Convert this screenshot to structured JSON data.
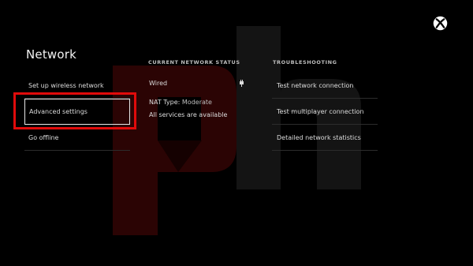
{
  "page": {
    "title": "Network"
  },
  "menu": {
    "items": [
      {
        "label": "Set up wireless network"
      },
      {
        "label": "Advanced settings"
      },
      {
        "label": "Go offline"
      }
    ]
  },
  "status": {
    "header": "CURRENT NETWORK STATUS",
    "connection": "Wired",
    "nat_label": "NAT Type:",
    "nat_value": "Moderate",
    "services": "All services are available"
  },
  "troubleshooting": {
    "header": "TROUBLESHOOTING",
    "items": [
      {
        "label": "Test network connection"
      },
      {
        "label": "Test multiplayer connection"
      },
      {
        "label": "Detailed network statistics"
      }
    ]
  },
  "icons": {
    "logo": "xbox-logo-icon",
    "connection": "ethernet-plug-icon"
  },
  "colors": {
    "background": "#000000",
    "highlight": "#e00b0b",
    "watermark_red": "#3a0505",
    "watermark_gray": "#161616"
  }
}
